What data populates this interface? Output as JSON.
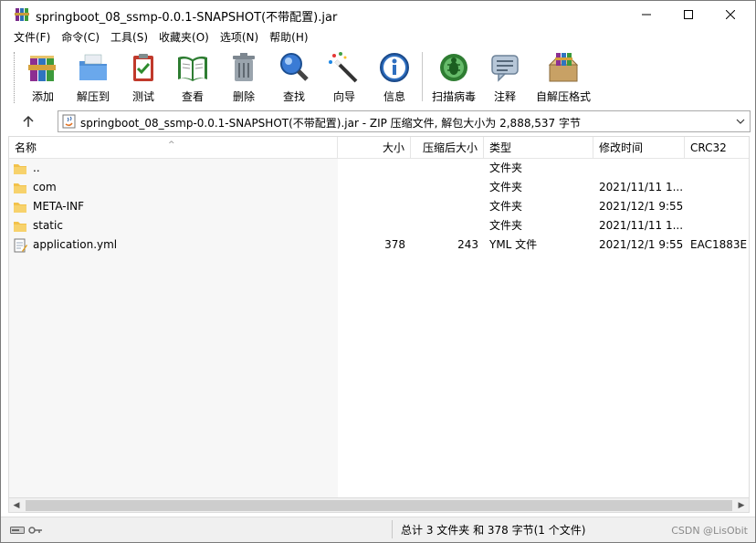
{
  "window": {
    "title": "springboot_08_ssmp-0.0.1-SNAPSHOT(不带配置).jar"
  },
  "menu": [
    {
      "label": "文件(F)"
    },
    {
      "label": "命令(C)"
    },
    {
      "label": "工具(S)"
    },
    {
      "label": "收藏夹(O)"
    },
    {
      "label": "选项(N)"
    },
    {
      "label": "帮助(H)"
    }
  ],
  "toolbar": {
    "buttons": [
      {
        "label": "添加",
        "icon": "add-archive-icon"
      },
      {
        "label": "解压到",
        "icon": "extract-to-icon"
      },
      {
        "label": "测试",
        "icon": "test-icon"
      },
      {
        "label": "查看",
        "icon": "view-icon"
      },
      {
        "label": "删除",
        "icon": "delete-icon"
      },
      {
        "label": "查找",
        "icon": "find-icon"
      },
      {
        "label": "向导",
        "icon": "wizard-icon"
      },
      {
        "label": "信息",
        "icon": "info-icon"
      },
      {
        "label": "扫描病毒",
        "icon": "virus-scan-icon"
      },
      {
        "label": "注释",
        "icon": "comment-icon"
      },
      {
        "label": "自解压格式",
        "icon": "sfx-icon"
      }
    ]
  },
  "address": {
    "text": "springboot_08_ssmp-0.0.1-SNAPSHOT(不带配置).jar - ZIP 压缩文件, 解包大小为 2,888,537 字节"
  },
  "columns": {
    "name": "名称",
    "size": "大小",
    "packed": "压缩后大小",
    "type": "类型",
    "modified": "修改时间",
    "crc": "CRC32"
  },
  "files": [
    {
      "name": "..",
      "size": "",
      "packed": "",
      "type": "文件夹",
      "modified": "",
      "crc": "",
      "kind": "folder"
    },
    {
      "name": "com",
      "size": "",
      "packed": "",
      "type": "文件夹",
      "modified": "2021/11/11 1...",
      "crc": "",
      "kind": "folder"
    },
    {
      "name": "META-INF",
      "size": "",
      "packed": "",
      "type": "文件夹",
      "modified": "2021/12/1 9:55",
      "crc": "",
      "kind": "folder"
    },
    {
      "name": "static",
      "size": "",
      "packed": "",
      "type": "文件夹",
      "modified": "2021/11/11 1...",
      "crc": "",
      "kind": "folder"
    },
    {
      "name": "application.yml",
      "size": "378",
      "packed": "243",
      "type": "YML 文件",
      "modified": "2021/12/1 9:55",
      "crc": "EAC1883E",
      "kind": "file"
    }
  ],
  "status": {
    "text": "总计 3 文件夹 和 378 字节(1 个文件)"
  },
  "watermark": "CSDN @LisObit"
}
